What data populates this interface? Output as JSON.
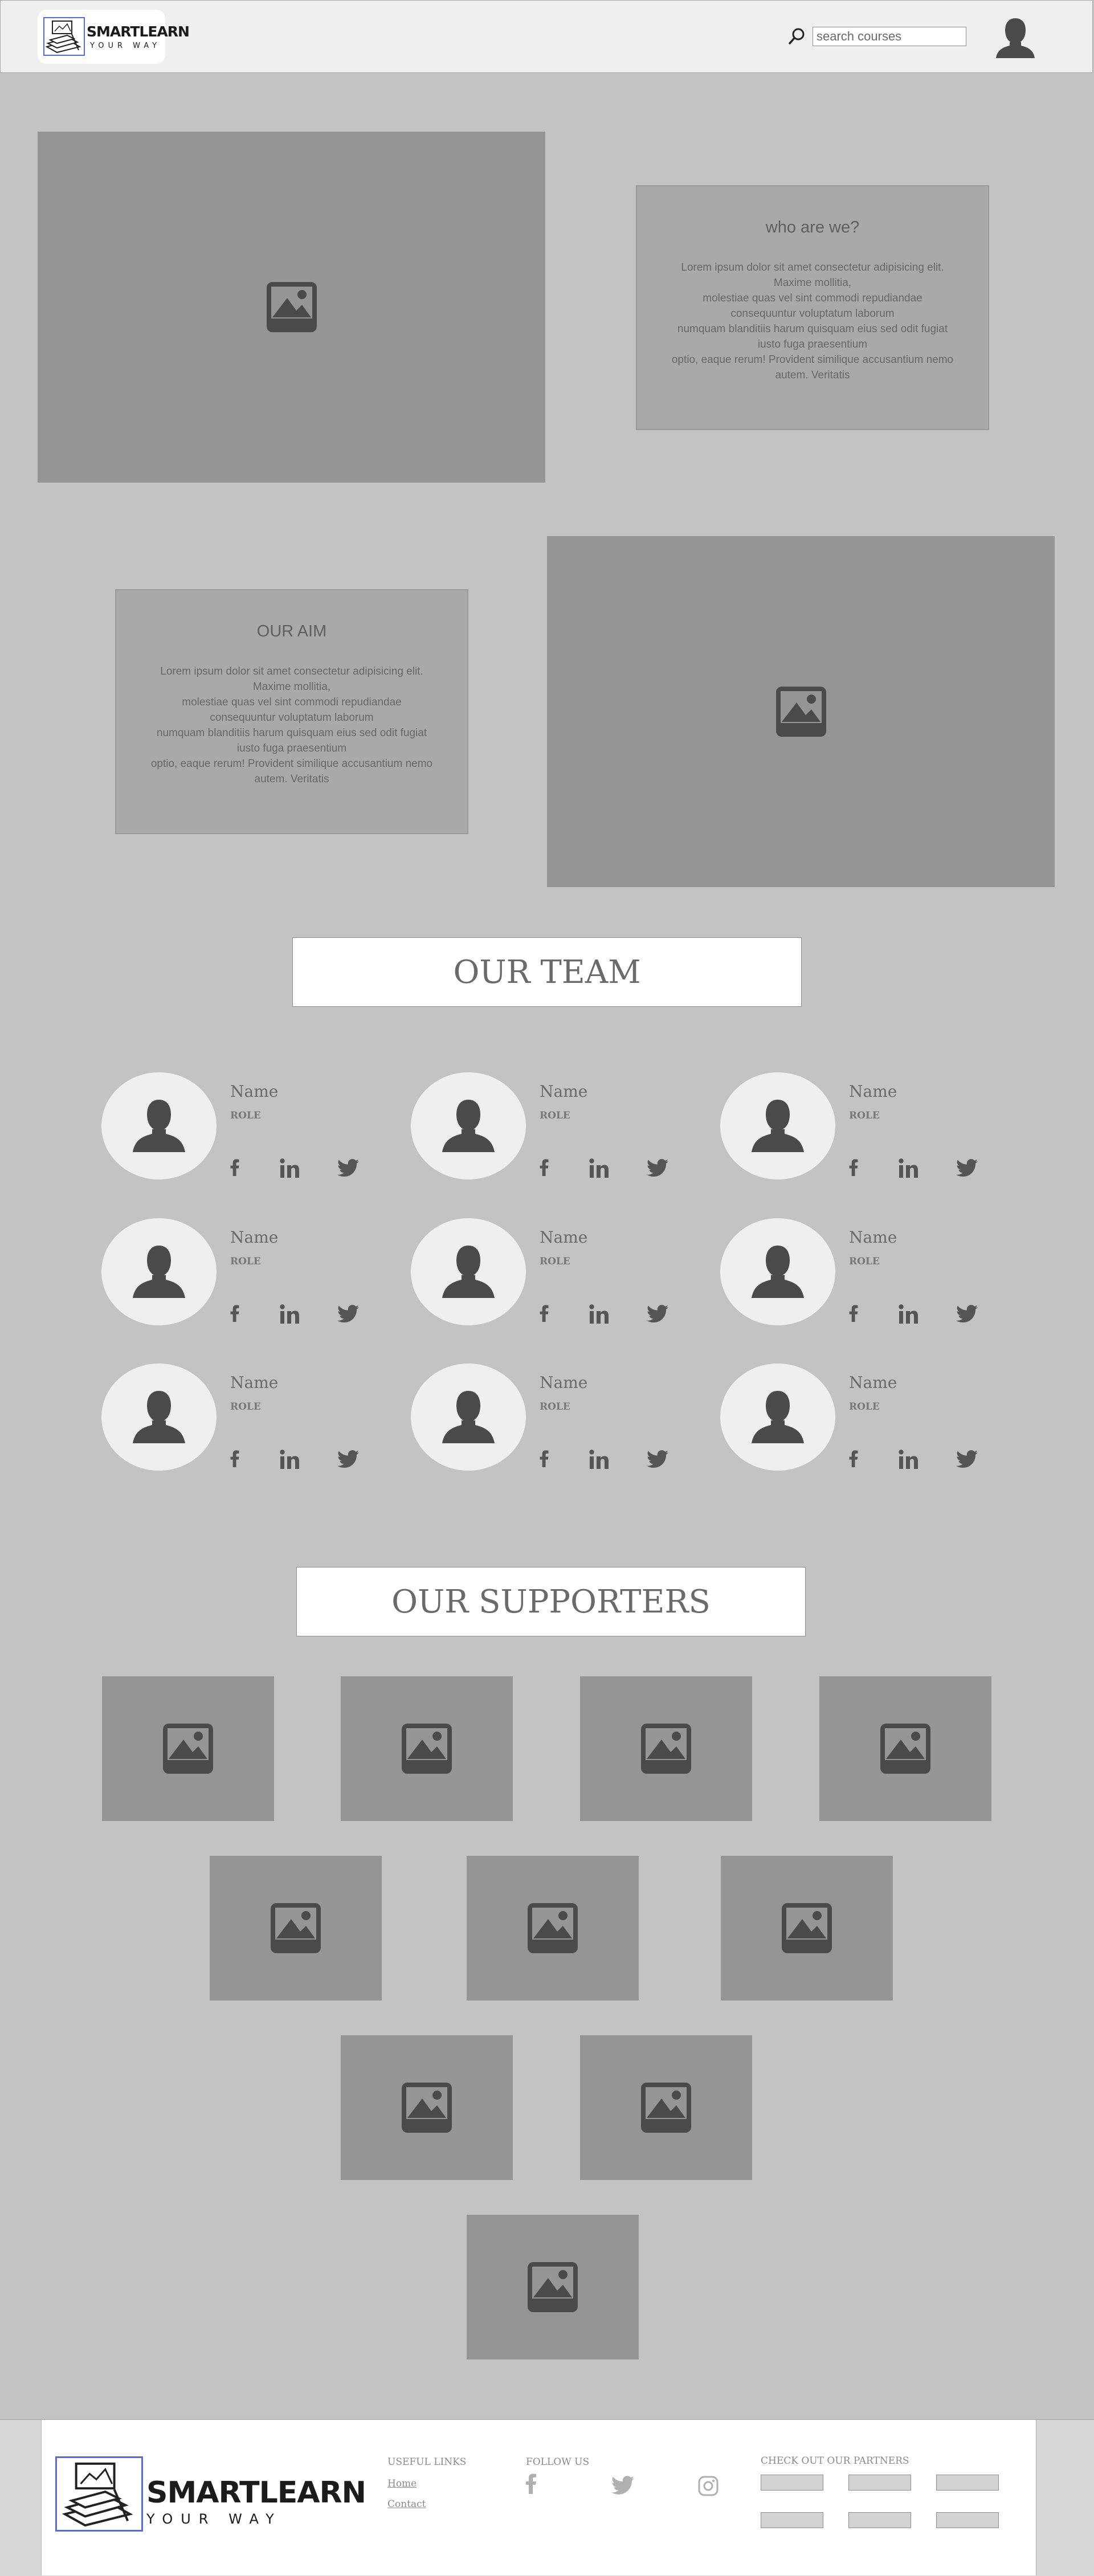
{
  "header": {
    "logo": {
      "word": "SMARTLEARN",
      "tagline": "YOUR WAY"
    },
    "search": {
      "placeholder": "search courses",
      "value": ""
    }
  },
  "about": {
    "who": {
      "title": "who are we?",
      "body": "Lorem ipsum dolor sit amet consectetur adipisicing elit.\nMaxime mollitia,\nmolestiae quas vel sint commodi repudiandae\nconsequuntur voluptatum laborum\nnumquam blanditiis harum quisquam eius sed odit fugiat\niusto fuga praesentium\noptio, eaque rerum! Provident similique accusantium nemo\nautem. Veritatis"
    },
    "aim": {
      "title": "OUR AIM",
      "body": "Lorem ipsum dolor sit amet consectetur adipisicing elit.\nMaxime mollitia,\nmolestiae quas vel sint commodi repudiandae\nconsequuntur voluptatum laborum\nnumquam blanditiis harum quisquam eius sed odit fugiat\niusto fuga praesentium\noptio, eaque rerum! Provident similique accusantium nemo\nautem. Veritatis"
    }
  },
  "team": {
    "title": "OUR TEAM",
    "members": [
      {
        "name": "Name",
        "role": "ROLE"
      },
      {
        "name": "Name",
        "role": "ROLE"
      },
      {
        "name": "Name",
        "role": "ROLE"
      },
      {
        "name": "Name",
        "role": "ROLE"
      },
      {
        "name": "Name",
        "role": "ROLE"
      },
      {
        "name": "Name",
        "role": "ROLE"
      },
      {
        "name": "Name",
        "role": "ROLE"
      },
      {
        "name": "Name",
        "role": "ROLE"
      },
      {
        "name": "Name",
        "role": "ROLE"
      }
    ]
  },
  "supporters": {
    "title": "OUR SUPPORTERS"
  },
  "footer": {
    "logo": {
      "word": "SMARTLEARN",
      "tagline": "YOUR WAY"
    },
    "useful_links": {
      "heading": "USEFUL LINKS",
      "links": [
        "Home",
        "Contact"
      ]
    },
    "follow_us": {
      "heading": "FOLLOW US"
    },
    "partners": {
      "heading": "CHECK OUT OUR PARTNERS"
    }
  },
  "colors": {
    "background": "#c3c3c3",
    "placeholder": "#959595",
    "panel": "#a9a9a9",
    "icon_dark": "#4a4a4a"
  }
}
